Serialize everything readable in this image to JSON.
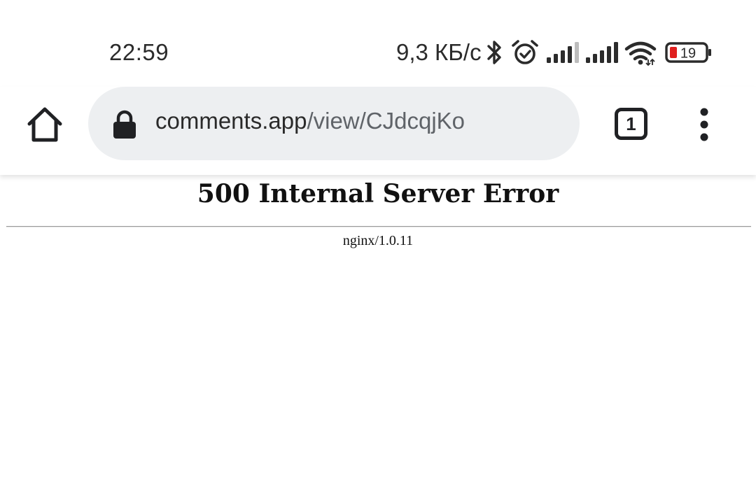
{
  "status_bar": {
    "time": "22:59",
    "net_speed": "9,3 КБ/с",
    "icons": [
      "bluetooth-icon",
      "alarm-icon",
      "signal-1-icon",
      "signal-2-icon",
      "wifi-icon",
      "battery-icon"
    ],
    "battery_level": "19",
    "battery_color": "#e0201f"
  },
  "browser": {
    "url_host": "comments.app",
    "url_path": "/view/CJdcqjKo",
    "tab_count": "1",
    "omnibox_color": "#edeff1",
    "icons": [
      "home-icon",
      "lock-icon",
      "tab-switcher-icon",
      "more-vert-icon"
    ]
  },
  "page": {
    "title": "500 Internal Server Error",
    "server": "nginx/1.0.11"
  }
}
